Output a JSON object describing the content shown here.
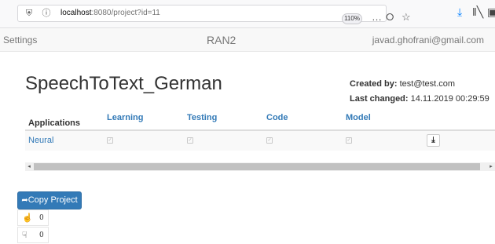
{
  "browser": {
    "url_host": "localhost",
    "url_rest": ":8080/project?id=11",
    "zoom": "110%",
    "icons": [
      "shield-icon",
      "info-icon",
      "more-icon",
      "pocket-icon",
      "bookmark-star-icon",
      "download-icon",
      "library-icon",
      "reader-icon"
    ]
  },
  "navbar": {
    "settings": "Settings",
    "brand": "RAN2",
    "email": "javad.ghofrani@gmail.com"
  },
  "project": {
    "title": "SpeechToText_German",
    "created_label": "Created by:",
    "created_value": "test@test.com",
    "changed_label": "Last changed:",
    "changed_value": "14.11.2019 00:29:59"
  },
  "table": {
    "headers": [
      "Applications",
      "Learning",
      "Testing",
      "Code",
      "Model"
    ],
    "rows": [
      {
        "name": "Neural",
        "learning": true,
        "testing": true,
        "code": true,
        "model": true
      }
    ]
  },
  "actions": {
    "copy_label": "Copy Project",
    "likes": "0",
    "dislikes": "0"
  },
  "colors": {
    "primary": "#337ab7",
    "navbar_bg": "#f8f8f8"
  }
}
